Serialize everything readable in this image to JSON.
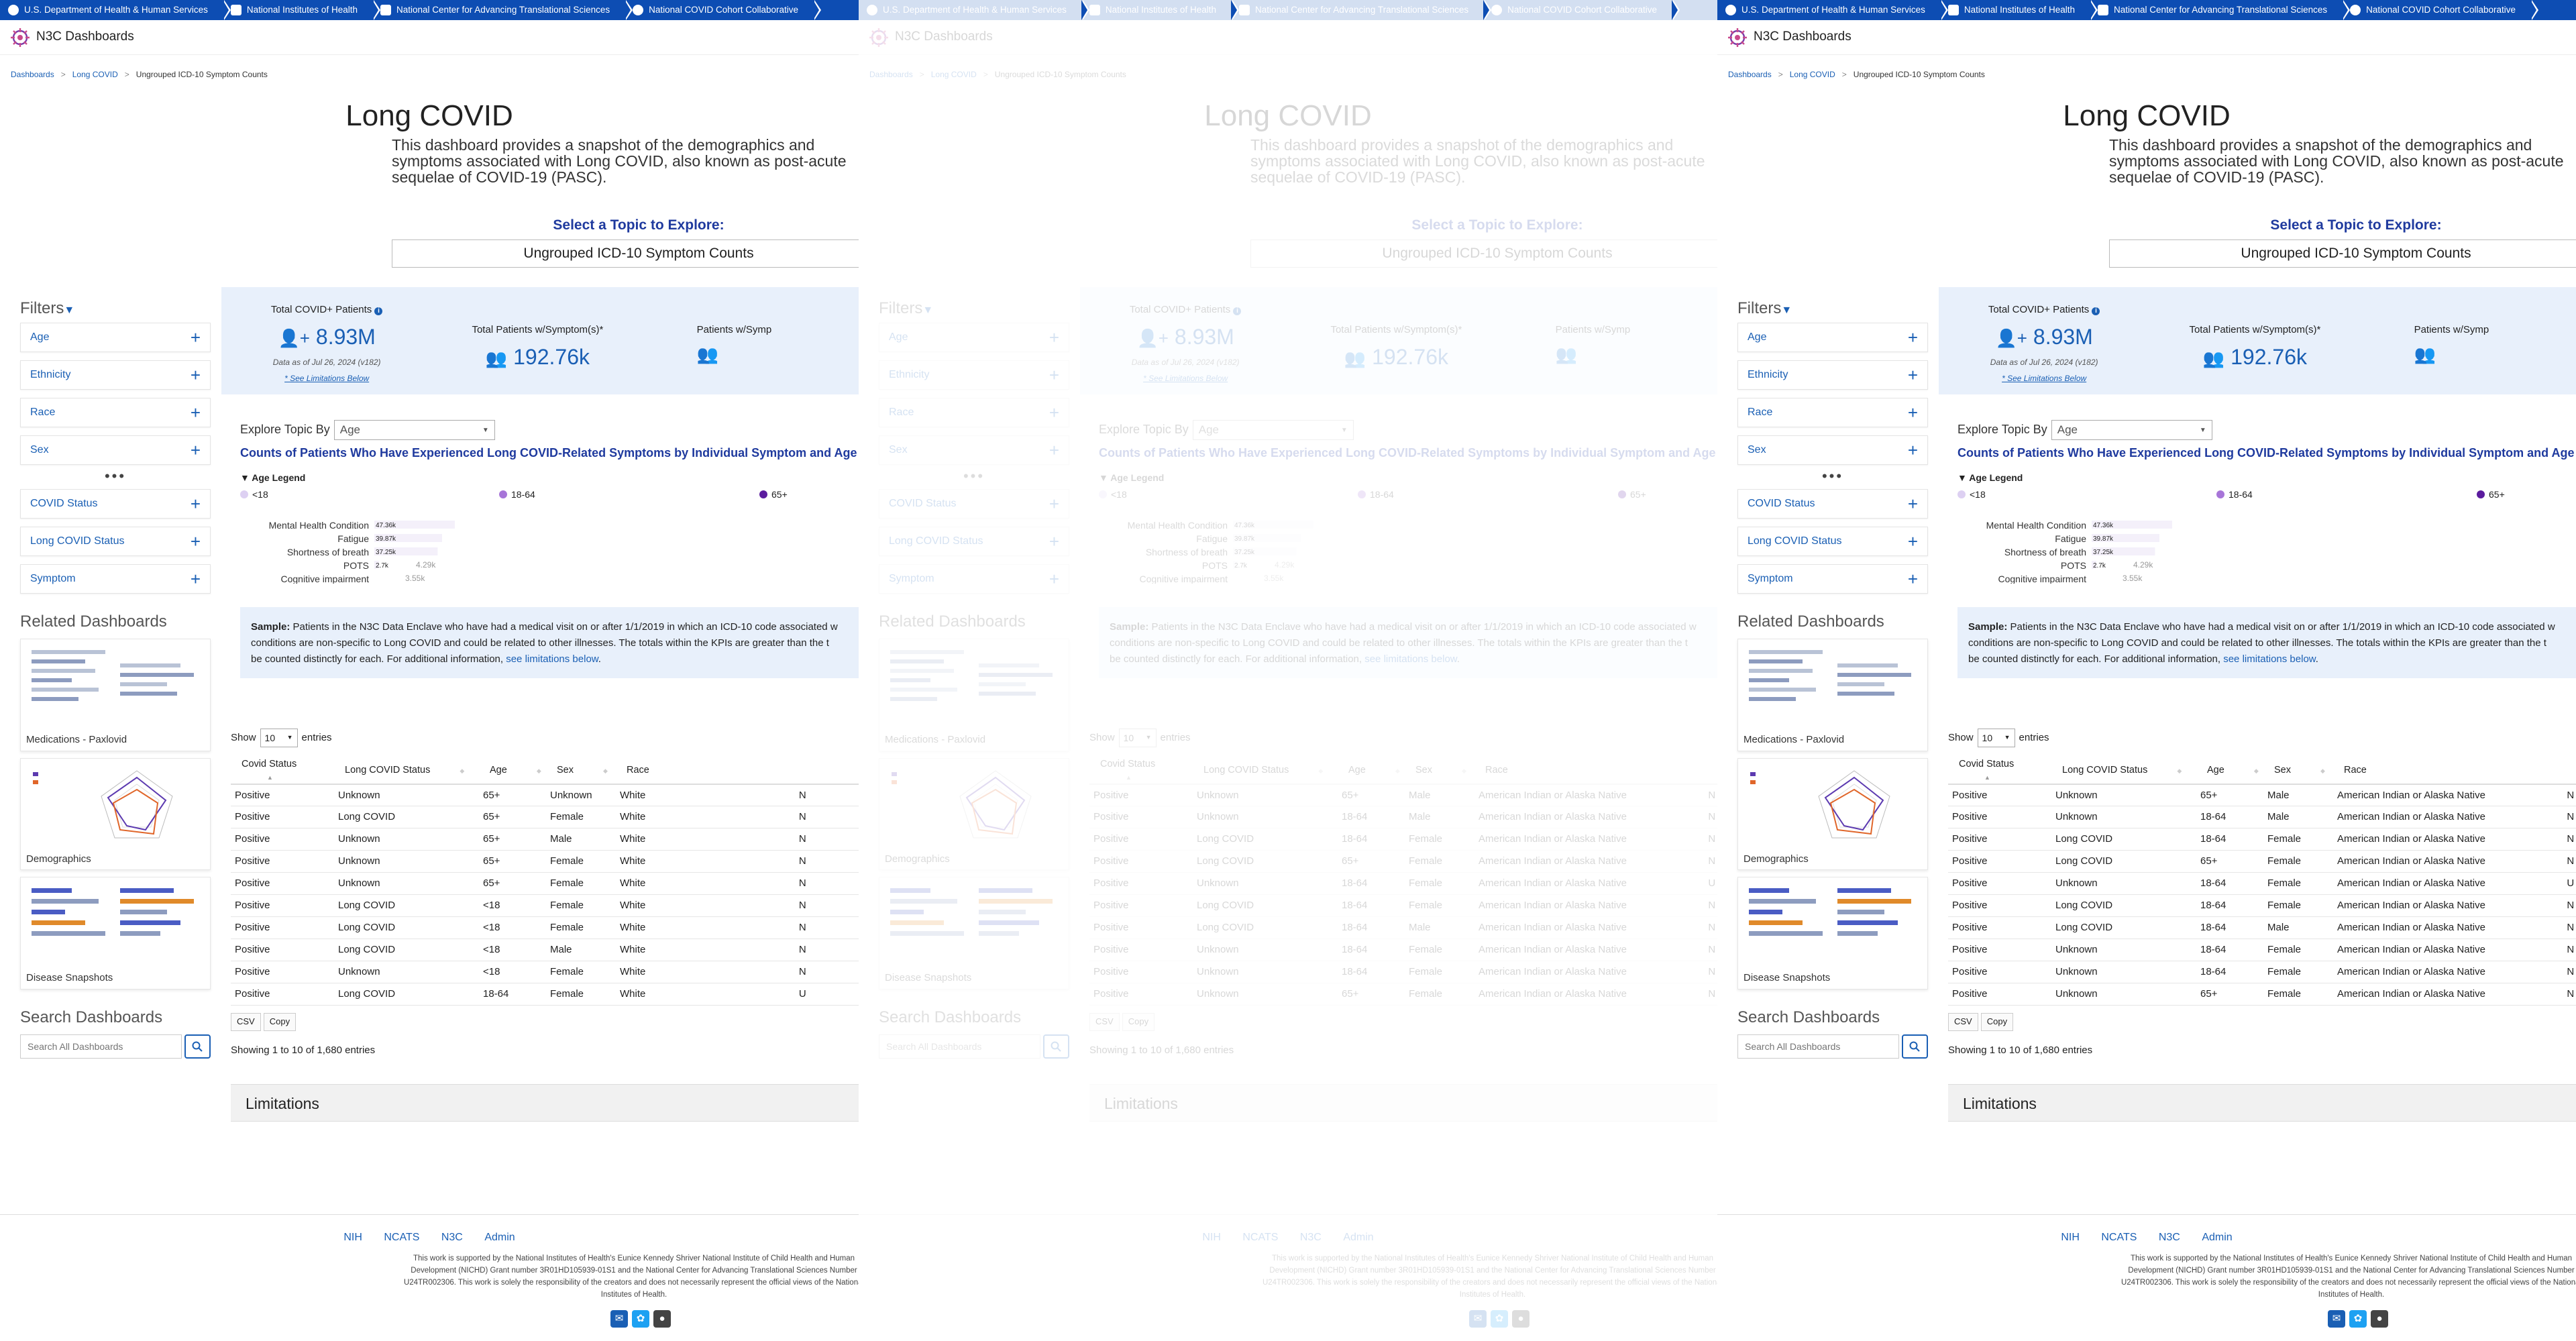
{
  "gov_bar": [
    {
      "label": "U.S. Department of Health & Human Services",
      "icon": "hhs-eagle-icon"
    },
    {
      "label": "National Institutes of Health",
      "icon": "nih-icon"
    },
    {
      "label": "National Center for Advancing Translational Sciences",
      "icon": "ncats-icon"
    },
    {
      "label": "National COVID Cohort Collaborative",
      "icon": "n3c-icon"
    }
  ],
  "site": {
    "title": "N3C Dashboards",
    "logo_icon": "n3c-logo-icon"
  },
  "breadcrumb": [
    "Dashboards",
    "Long COVID",
    "Ungrouped ICD-10 Symptom Counts"
  ],
  "page": {
    "title": "Long COVID",
    "intro": "This dashboard provides a snapshot of the demographics and symptoms associated with Long COVID, also known as post-acute sequelae of COVID-19 (PASC).",
    "topic_label": "Select a Topic to Explore:",
    "topic_value": "Ungrouped ICD-10 Symptom Counts"
  },
  "filters": {
    "title": "Filters",
    "items": [
      "Age",
      "Ethnicity",
      "Race",
      "Sex"
    ],
    "more": "•••",
    "items2": [
      "COVID Status",
      "Long COVID Status",
      "Symptom"
    ]
  },
  "related": {
    "title": "Related Dashboards",
    "cards": [
      "Medications - Paxlovid",
      "Demographics",
      "Disease Snapshots"
    ]
  },
  "search": {
    "title": "Search Dashboards",
    "placeholder": "Search All Dashboards"
  },
  "kpis": [
    {
      "label": "Total COVID+ Patients",
      "value": "8.93M",
      "note": "Data as of Jul 26, 2024 (v182)",
      "link": "* See Limitations Below"
    },
    {
      "label": "Total Patients w/Symptom(s)*",
      "value": "192.76k"
    },
    {
      "label": "Patients w/Symp",
      "value": ""
    }
  ],
  "explore": {
    "label": "Explore Topic By",
    "value": "Age",
    "title": "Counts of Patients Who Have Experienced Long COVID-Related Symptoms by Individual Symptom and Age",
    "legend_title": "Age Legend",
    "legend": [
      {
        "label": "<18",
        "color": "#ddd0f2"
      },
      {
        "label": "18-64",
        "color": "#a775d8"
      },
      {
        "label": "65+",
        "color": "#5b1c9e"
      }
    ]
  },
  "chart_data": {
    "type": "bar",
    "categories": [
      "Mental Health Condition",
      "Fatigue",
      "Shortness of breath",
      "POTS",
      "Cognitive impairment"
    ],
    "values": [
      47.36,
      39.87,
      37.25,
      2.7,
      0
    ],
    "data_labels": [
      "47.36k",
      "39.87k",
      "37.25k",
      "2.7k",
      ""
    ],
    "extra_labels": [
      "",
      "",
      "",
      "4.29k",
      "3.55k"
    ],
    "units": "k"
  },
  "sample": {
    "label": "Sample:",
    "line1": "Patients in the N3C Data Enclave who have had a medical visit on or after 1/1/2019 in which an ICD-10 code associated w",
    "line2": "conditions are non-specific to Long COVID and could be related to other illnesses. The totals within the KPIs are greater than the t",
    "line3a": "be counted distinctly for each. For additional information, ",
    "line3link": "see limitations below",
    "line3b": "."
  },
  "table": {
    "show_label": "Show",
    "show_value": "10",
    "entries_label": "entries",
    "columns": [
      "Covid Status",
      "Long COVID Status",
      "Age",
      "Sex",
      "Race"
    ],
    "info": "Showing 1 to 10 of 1,680 entries",
    "buttons": [
      "CSV",
      "Copy"
    ]
  },
  "rows_a": [
    [
      "Positive",
      "Unknown",
      "65+",
      "Unknown",
      "White",
      "N"
    ],
    [
      "Positive",
      "Long COVID",
      "65+",
      "Female",
      "White",
      "N"
    ],
    [
      "Positive",
      "Unknown",
      "65+",
      "Male",
      "White",
      "N"
    ],
    [
      "Positive",
      "Unknown",
      "65+",
      "Female",
      "White",
      "N"
    ],
    [
      "Positive",
      "Unknown",
      "65+",
      "Female",
      "White",
      "N"
    ],
    [
      "Positive",
      "Long COVID",
      "<18",
      "Female",
      "White",
      "N"
    ],
    [
      "Positive",
      "Long COVID",
      "<18",
      "Female",
      "White",
      "N"
    ],
    [
      "Positive",
      "Long COVID",
      "<18",
      "Male",
      "White",
      "N"
    ],
    [
      "Positive",
      "Unknown",
      "<18",
      "Female",
      "White",
      "N"
    ],
    [
      "Positive",
      "Long COVID",
      "18-64",
      "Female",
      "White",
      "U"
    ]
  ],
  "rows_b": [
    [
      "Positive",
      "Unknown",
      "65+",
      "Male",
      "American Indian or Alaska Native",
      "N"
    ],
    [
      "Positive",
      "Unknown",
      "18-64",
      "Male",
      "American Indian or Alaska Native",
      "N"
    ],
    [
      "Positive",
      "Long COVID",
      "18-64",
      "Female",
      "American Indian or Alaska Native",
      "N"
    ],
    [
      "Positive",
      "Long COVID",
      "65+",
      "Female",
      "American Indian or Alaska Native",
      "N"
    ],
    [
      "Positive",
      "Unknown",
      "18-64",
      "Female",
      "American Indian or Alaska Native",
      "U"
    ],
    [
      "Positive",
      "Long COVID",
      "18-64",
      "Female",
      "American Indian or Alaska Native",
      "N"
    ],
    [
      "Positive",
      "Long COVID",
      "18-64",
      "Male",
      "American Indian or Alaska Native",
      "N"
    ],
    [
      "Positive",
      "Unknown",
      "18-64",
      "Female",
      "American Indian or Alaska Native",
      "N"
    ],
    [
      "Positive",
      "Unknown",
      "18-64",
      "Female",
      "American Indian or Alaska Native",
      "N"
    ],
    [
      "Positive",
      "Unknown",
      "65+",
      "Female",
      "American Indian or Alaska Native",
      "N"
    ]
  ],
  "limitations": {
    "title": "Limitations"
  },
  "footer": {
    "links": [
      "NIH",
      "NCATS",
      "N3C",
      "Admin"
    ],
    "text": "This work is supported by the National Institutes of Health's Eunice Kennedy Shriver National Institute of Child Health and Human Development (NICHD) Grant number 3R01HD105939-01S1 and the National Center for Advancing Translational Sciences Number U24TR002306. This work is solely the responsibility of the creators and does not necessarily represent the official views of the National Institutes of Health.",
    "icons": [
      {
        "name": "email-icon",
        "color": "#1a5fb4"
      },
      {
        "name": "twitter-icon",
        "color": "#1da1f2"
      },
      {
        "name": "github-icon",
        "color": "#444444"
      }
    ]
  },
  "colors": {
    "accent": "#1a5fb4",
    "gov_bar": "#0d4db3",
    "kpi_bg": "#e8f0fb",
    "heading": "#1f3a9e"
  }
}
